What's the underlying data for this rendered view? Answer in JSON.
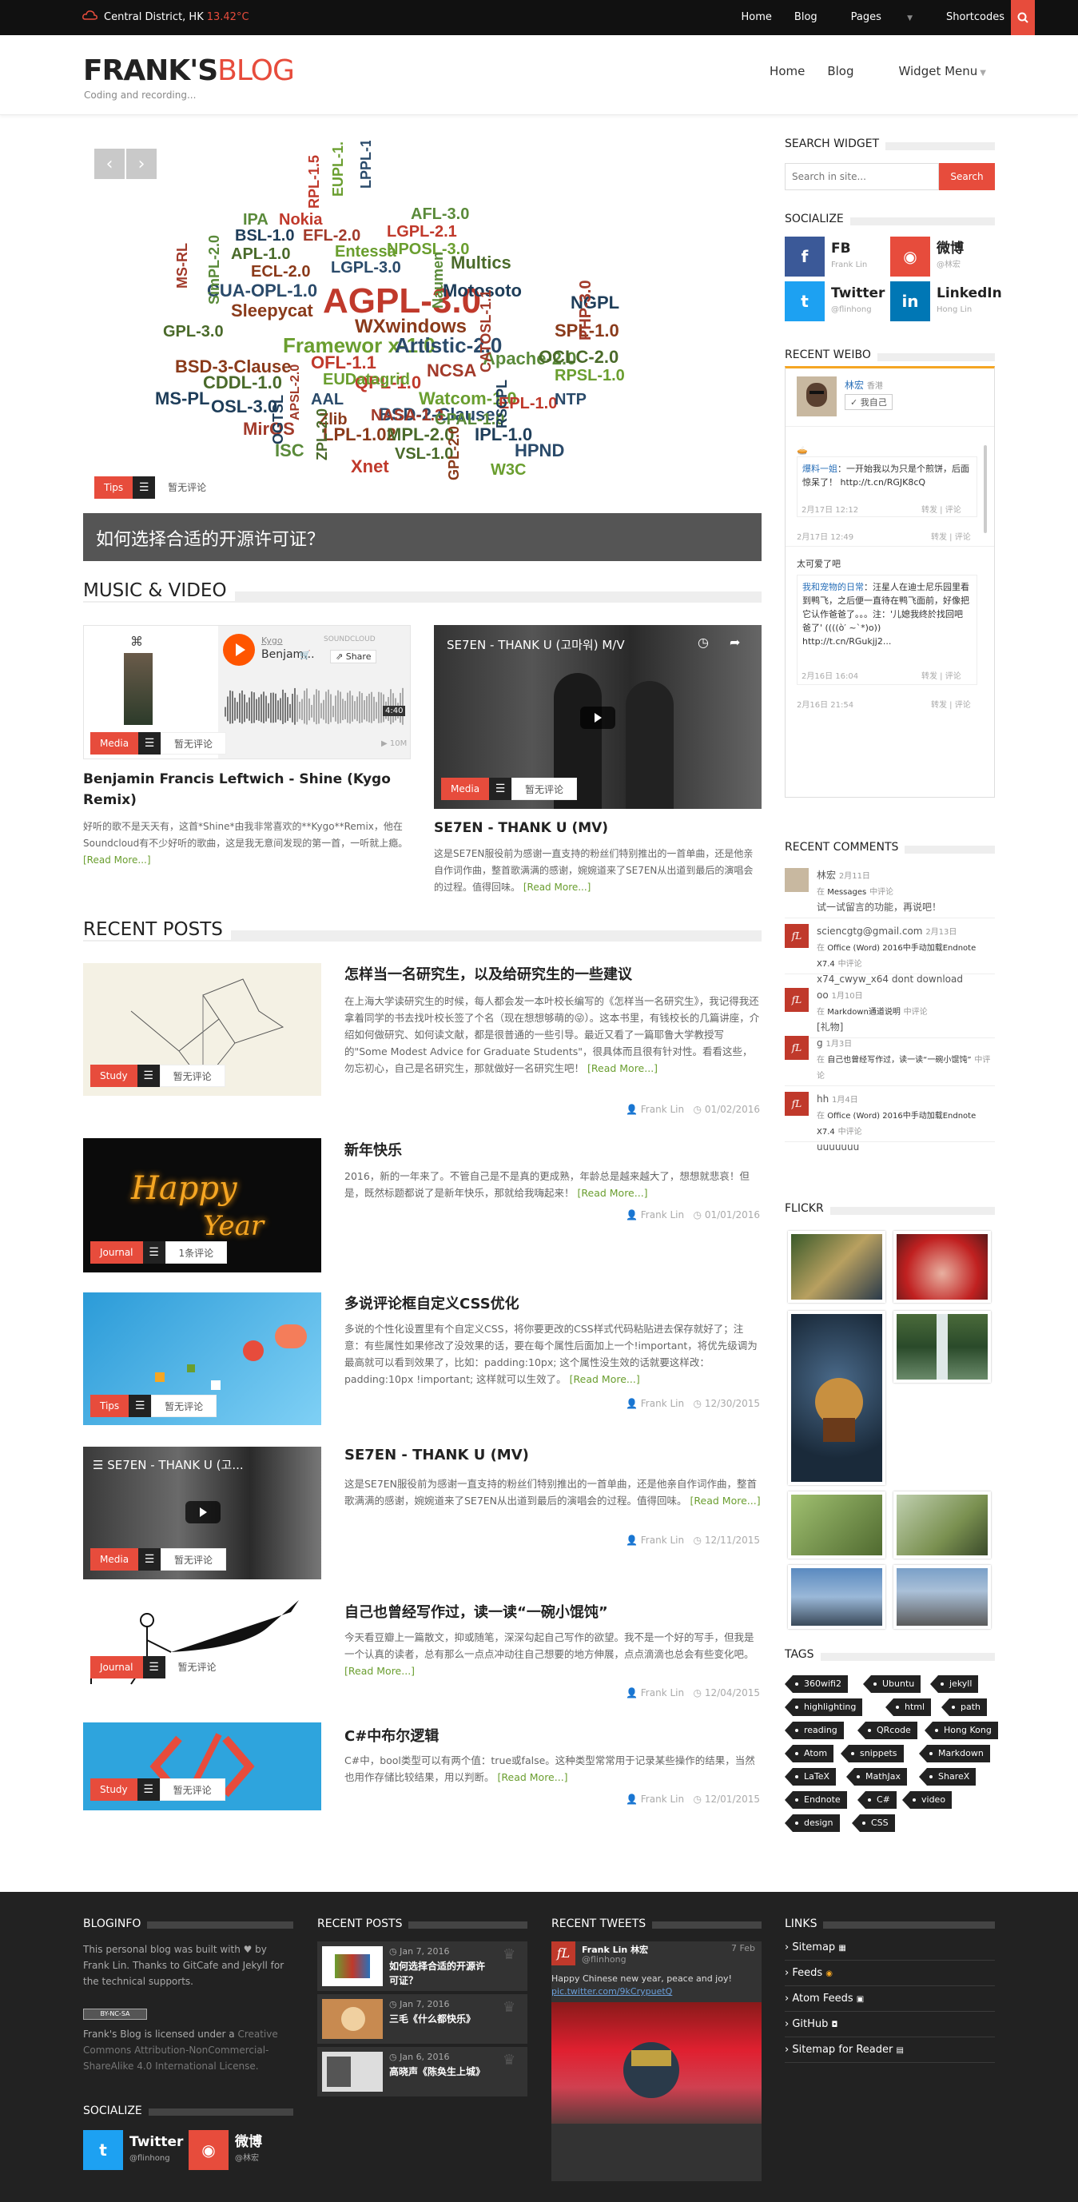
{
  "topbar": {
    "location": "Central District, HK",
    "temp": "13.42°C",
    "nav": [
      "Home",
      "Blog",
      "Pages",
      "Shortcodes"
    ]
  },
  "header": {
    "logo_a": "FRANK'S",
    "logo_b": "BLOG",
    "tagline": "Coding and recording...",
    "nav": [
      "Home",
      "Blog",
      "Widget Menu"
    ]
  },
  "slider": {
    "caption": "如何选择合适的开源许可证？",
    "category": "Tips",
    "comments": "暂无评论",
    "words": [
      "AGPL-3.0",
      "Framewor x-1.0",
      "Artistic-2.0",
      "WXwindows",
      "Multics",
      "Motosoto",
      "NCSA",
      "Apache-2.0",
      "QPL-1.0",
      "Watcom-1.0",
      "BSD-2-Clause",
      "BSD-3-Clause",
      "CDDL-1.0",
      "OSL-3.0",
      "MirOS",
      "ISC",
      "Xnet",
      "W3C",
      "HPND",
      "LPL-1.02",
      "MPL-2.0",
      "IPL-1.0",
      "NASA-1.3",
      "CPAL-1.0",
      "EPL-1.0",
      "RPSL-1.0",
      "NTP",
      "SPL-1.0",
      "OCLC-2.0",
      "NGPL",
      "PHP-3.0",
      "AFL-3.0",
      "LGPL-2.1",
      "NPOSL-3.0",
      "LGPL-3.0",
      "ECL-2.0",
      "APL-1.0",
      "BSL-1.0",
      "EFL-2.0",
      "IPA",
      "Nokia",
      "Entessa",
      "CUA-OPL-1.0",
      "Sleepycat",
      "GPL-3.0",
      "MS-PL",
      "MS-RL",
      "SimPL-2.0",
      "OFL-1.1",
      "EUDatagrid",
      "AAL",
      "Zlib",
      "VSL-1.0",
      "RSCPL",
      "CATOSL-1.1",
      "Naumen",
      "RPL-1.5",
      "EUPL-1.1",
      "LPPL-1.3c",
      "GPL-2.0",
      "ZPL-2.0",
      "OGTSL",
      "APSL-2.0"
    ]
  },
  "music": {
    "heading": "MUSIC & VIDEO",
    "items": [
      {
        "title": "Benjamin Francis Leftwich - Shine (Kygo Remix)",
        "category": "Media",
        "comments": "暂无评论",
        "text": "好听的歌不是天天有，这首*Shine*由我非常喜欢的**Kygo**Remix，他在Soundcloud有不少好听的歌曲，这是我无意间发现的第一首，一听就上瘾。",
        "more": "[Read More...]",
        "player_artist": "Kygo",
        "player_track": "Benjam...",
        "player_brand": "SOUNDCLOUD",
        "player_share": "Share",
        "player_time": "4:40",
        "player_plays": "10M"
      },
      {
        "title": "SE7EN - THANK U (MV)",
        "category": "Media",
        "comments": "暂无评论",
        "text": "这是SE7EN服役前为感谢一直支持的粉丝们特别推出的一首单曲，还是他亲自作词作曲，整首歌满满的感谢，婉婉道来了SE7EN从出道到最后的演唱会的过程。值得回味。",
        "more": "[Read More...]",
        "video_title": "SE7EN - THANK U (고마워) M/V"
      }
    ]
  },
  "posts": {
    "heading": "RECENT POSTS",
    "items": [
      {
        "title": "怎样当一名研究生，以及给研究生的一些建议",
        "category": "Study",
        "comments": "暂无评论",
        "author": "Frank Lin",
        "date": "01/02/2016",
        "text": "在上海大学读研究生的时候，每人都会发一本叶校长编写的《怎样当一名研究生》，我记得我还拿着同学的书去找叶校长签了个名（现在想想够萌的😜）。这本书里，有钱校长的几篇讲座，介绍如何做研究、如何读文献，都是很普通的一些引导。最近又看了一篇耶鲁大学教授写的\"Some Modest Advice for Graduate Students\"，很具体而且很有针对性。看看这些，勿忘初心，自己是名研究生，那就做好一名研究生吧！",
        "more": "[Read More...]"
      },
      {
        "title": "新年快乐",
        "category": "Journal",
        "comments": "1条评论",
        "author": "Frank Lin",
        "date": "01/01/2016",
        "text": "2016，新的一年来了。不管自己是不是真的更成熟，年龄总是越来越大了，想想就悲哀！但是，既然标题都说了是新年快乐，那就给我嗨起来！",
        "more": "[Read More...]"
      },
      {
        "title": "多说评论框自定义CSS优化",
        "category": "Tips",
        "comments": "暂无评论",
        "author": "Frank Lin",
        "date": "12/30/2015",
        "text": "多说的个性化设置里有个自定义CSS，将你要更改的CSS样式代码粘贴进去保存就好了；注意：有些属性如果修改了没效果的话，要在每个属性后面加上一个!important，将优先级调为最高就可以看到效果了，比如：padding:10px; 这个属性没生效的话就要这样改：padding:10px !important; 这样就可以生效了。",
        "more": "[Read More...]"
      },
      {
        "title": "SE7EN - THANK U (MV)",
        "category": "Media",
        "comments": "暂无评论",
        "author": "Frank Lin",
        "date": "12/11/2015",
        "text": "这是SE7EN服役前为感谢一直支持的粉丝们特别推出的一首单曲，还是他亲自作词作曲，整首歌满满的感谢，婉婉道来了SE7EN从出道到最后的演唱会的过程。值得回味。",
        "more": "[Read More...]",
        "video_title": "SE7EN - THANK U (고..."
      },
      {
        "title": "自己也曾经写作过，读一读“一碗小馄饨”",
        "category": "Journal",
        "comments": "暂无评论",
        "author": "Frank Lin",
        "date": "12/04/2015",
        "text": "今天看豆瓣上一篇散文，抑或随笔，深深勾起自己写作的欲望。我不是一个好的写手，但我是一个认真的读者，总有那么一点点冲动往自己想要的地方伸展，点点滴滴也总会有些变化吧。",
        "more": "[Read More...]"
      },
      {
        "title": "C#中布尔逻辑",
        "category": "Study",
        "comments": "暂无评论",
        "author": "Frank Lin",
        "date": "12/01/2015",
        "text": "C#中，bool类型可以有两个值：true或false。这种类型常常用于记录某些操作的结果，当然也用作存储比较结果，用以判断。",
        "more": "[Read More...]"
      }
    ]
  },
  "sidebar": {
    "search": {
      "heading": "SEARCH WIDGET",
      "placeholder": "Search in site...",
      "button": "Search"
    },
    "socialize": {
      "heading": "SOCIALIZE",
      "items": [
        {
          "name": "FB",
          "sub": "Frank Lin",
          "color": "#3b5998",
          "icon": "facebook-icon"
        },
        {
          "name": "微博",
          "sub": "@林宏",
          "color": "#e74c3c",
          "icon": "weibo-icon"
        },
        {
          "name": "Twitter",
          "sub": "@flinhong",
          "color": "#1da1f2",
          "icon": "twitter-icon"
        },
        {
          "name": "LinkedIn",
          "sub": "Hong Lin",
          "color": "#0077b5",
          "icon": "linkedin-icon"
        }
      ]
    },
    "weibo": {
      "heading": "RECENT WEIBO",
      "user": "林宏",
      "loc": "香港",
      "follow": "我自己",
      "posts": [
        {
          "author": "爆料一姐",
          "text": "：一开始我以为只是个煎饼，后面惊呆了！ http://t.cn/RGJK8cQ",
          "time": "2月17日 12:12",
          "actions": "转发 | 评论",
          "outer_time": "2月17日 12:49",
          "outer_actions": "转发 | 评论"
        },
        {
          "intro": "太可爱了吧",
          "author": "我和宠物的日常",
          "text": "：汪星人在迪士尼乐园里看到鸭飞，之后便一直待在鸭飞面前，好像把它认作爸爸了。。。注：'儿媳我终於找回吧爸了' ((((ò′ ~`*)o)) http://t.cn/RGukjj2...",
          "time": "2月16日 16:04",
          "actions": "转发 | 评论",
          "outer_time": "2月16日 21:54",
          "outer_actions": "转发 | 评论"
        }
      ]
    },
    "comments": {
      "heading": "RECENT COMMENTS",
      "items": [
        {
          "author": "林宏",
          "time": "2月11日",
          "on": "Messages",
          "mid": "中评论",
          "text": "试一试留言的功能，再说吧！"
        },
        {
          "author": "sciencgtg@gmail.com",
          "time": "2月13日",
          "on": "Office (Word) 2016中手动加载Endnote X7.4",
          "mid": "中评论",
          "text": "x74_cwyw_x64 dont download"
        },
        {
          "author": "oo",
          "time": "1月10日",
          "on": "Markdown通道说明",
          "mid": "中评论",
          "text": "[礼物]"
        },
        {
          "author": "g",
          "time": "1月3日",
          "on": "自己也曾经写作过，读一读“一碗小馄饨”",
          "mid": "中评论",
          "text": ""
        },
        {
          "author": "hh",
          "time": "1月4日",
          "on": "Office (Word) 2016中手动加载Endnote X7.4",
          "mid": "中评论",
          "text": "uuuuuuu"
        }
      ]
    },
    "flickr_heading": "FLICKR",
    "tags": {
      "heading": "TAGS",
      "items": [
        "360wifi2",
        "Ubuntu",
        "jekyll",
        "highlighting",
        "html",
        "path",
        "reading",
        "QRcode",
        "Hong Kong",
        "Atom",
        "snippets",
        "Markdown",
        "LaTeX",
        "MathJax",
        "ShareX",
        "Endnote",
        "C#",
        "video",
        "design",
        "CSS"
      ]
    }
  },
  "footer": {
    "bloginfo": {
      "heading": "BLOGINFO",
      "text1": "This personal blog was built with ♥ by Frank Lin. Thanks to GitCafe and Jekyll for the technical supports.",
      "cc": "BY-NC-SA",
      "text2": "Frank's Blog is licensed under a ",
      "license": "Creative Commons Attribution-NonCommercial-ShareAlike 4.0 International License."
    },
    "socialize": {
      "heading": "SOCIALIZE",
      "items": [
        {
          "name": "Twitter",
          "sub": "@flinhong"
        },
        {
          "name": "微博",
          "sub": "@林宏"
        }
      ]
    },
    "recent": {
      "heading": "RECENT POSTS",
      "items": [
        {
          "date": "Jan 7, 2016",
          "title": "如何选择合适的开源许可证？"
        },
        {
          "date": "Jan 7, 2016",
          "title": "三毛《什么都快乐》"
        },
        {
          "date": "Jan 6, 2016",
          "title": "高晓声《陈奂生上城》"
        }
      ]
    },
    "tweets": {
      "heading": "RECENT TWEETS",
      "name": "Frank Lin 林宏",
      "handle": "@flinhong",
      "date": "7 Feb",
      "text": "Happy Chinese new year, peace and joy!",
      "link": "pic.twitter.com/9kCrypuetQ"
    },
    "links": {
      "heading": "LINKS",
      "items": [
        "Sitemap",
        "Feeds",
        "Atom Feeds",
        "GitHub",
        "Sitemap for Reader"
      ]
    }
  }
}
